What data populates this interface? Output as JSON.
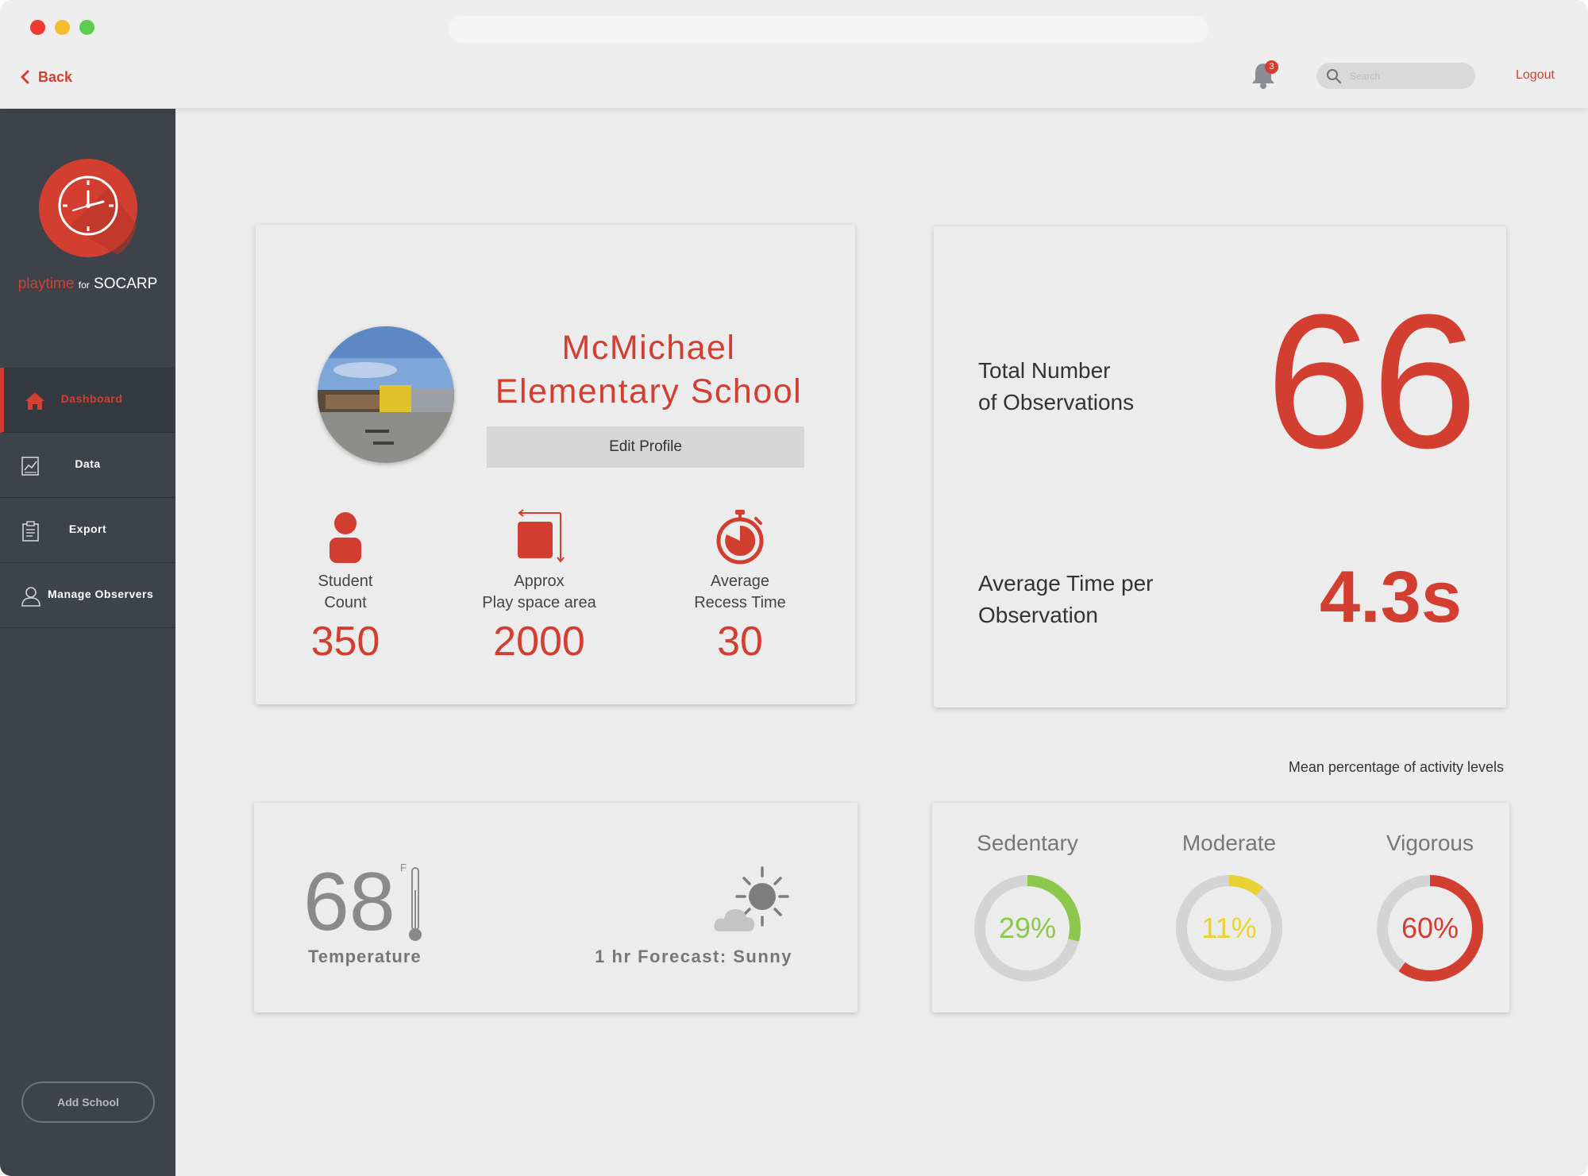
{
  "header": {
    "back_label": "Back",
    "notification_count": "3",
    "search_placeholder": "Search",
    "logout_label": "Logout"
  },
  "sidebar": {
    "brand_part1": "playtime",
    "brand_part2": "for",
    "brand_part3": "SOCARP",
    "items": [
      {
        "label": "Dashboard",
        "icon": "home-icon",
        "active": true
      },
      {
        "label": "Data",
        "icon": "chart-icon"
      },
      {
        "label": "Export",
        "icon": "document-icon"
      },
      {
        "label": "Manage Observers",
        "icon": "user-icon"
      }
    ],
    "add_school_label": "Add School"
  },
  "school": {
    "name_line1": "McMichael",
    "name_line2": "Elementary School",
    "edit_profile_label": "Edit Profile",
    "stats": [
      {
        "label_line1": "Student",
        "label_line2": "Count",
        "value": "350",
        "icon": "student-icon"
      },
      {
        "label_line1": "Approx",
        "label_line2": "Play space area",
        "value": "2000",
        "icon": "area-icon"
      },
      {
        "label_line1": "Average",
        "label_line2": "Recess Time",
        "value": "30",
        "icon": "stopwatch-icon"
      }
    ]
  },
  "observations": {
    "total_label_line1": "Total Number",
    "total_label_line2": "of Observations",
    "total_value": "66",
    "avg_label_line1": "Average Time per",
    "avg_label_line2": "Observation",
    "avg_value": "4.3s"
  },
  "weather": {
    "temperature": "68",
    "unit": "F",
    "temperature_label": "Temperature",
    "forecast_label": "1 hr Forecast: Sunny",
    "icon": "partly-sunny-icon"
  },
  "activity": {
    "caption": "Mean percentage of activity levels",
    "levels": [
      {
        "name": "Sedentary",
        "label": "29%",
        "percent": 29,
        "color": "#8cc84b"
      },
      {
        "name": "Moderate",
        "label": "11%",
        "percent": 11,
        "color": "#e8d234"
      },
      {
        "name": "Vigorous",
        "label": "60%",
        "percent": 60,
        "color": "#d23f31"
      }
    ]
  },
  "colors": {
    "accent": "#d23f31",
    "sidebar": "#3e434a",
    "background": "#ececec"
  }
}
